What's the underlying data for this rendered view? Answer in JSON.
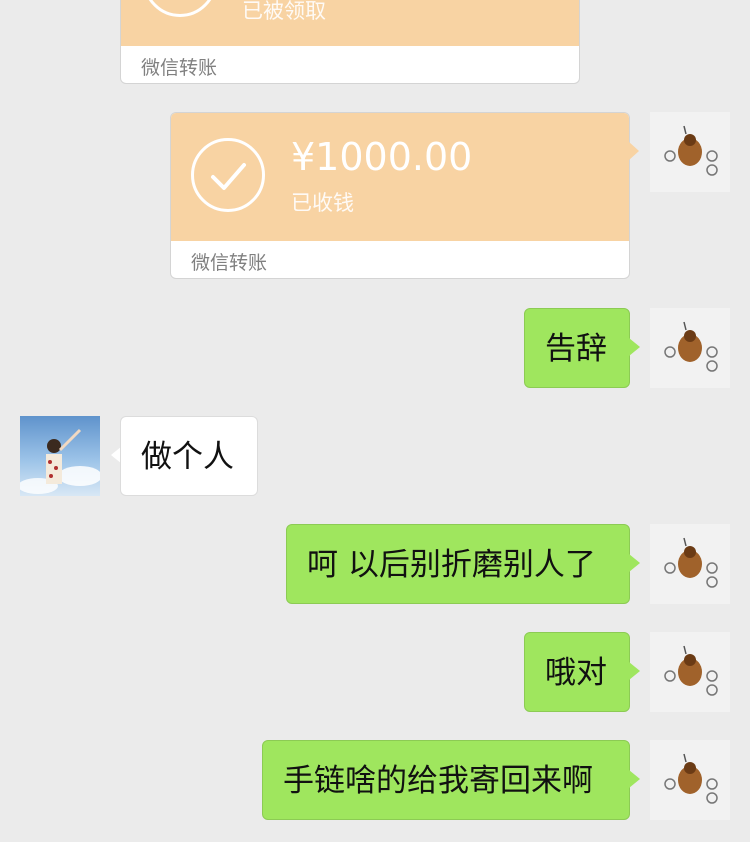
{
  "transfers": [
    {
      "status": "已被领取",
      "footer": "微信转账"
    },
    {
      "amount": "¥1000.00",
      "status": "已收钱",
      "footer": "微信转账"
    }
  ],
  "messages": [
    {
      "sender": "me",
      "text": "告辞"
    },
    {
      "sender": "other",
      "text": "做个人"
    },
    {
      "sender": "me",
      "text": "呵 以后别折磨别人了"
    },
    {
      "sender": "me",
      "text": "哦对"
    },
    {
      "sender": "me",
      "text": "手链啥的给我寄回来啊"
    }
  ],
  "colors": {
    "background": "#ebebeb",
    "transfer_card": "#f8d3a3",
    "my_bubble": "#9fe65e",
    "other_bubble": "#ffffff"
  },
  "icons": [
    "check-circle-icon",
    "avatar-me",
    "avatar-other"
  ]
}
